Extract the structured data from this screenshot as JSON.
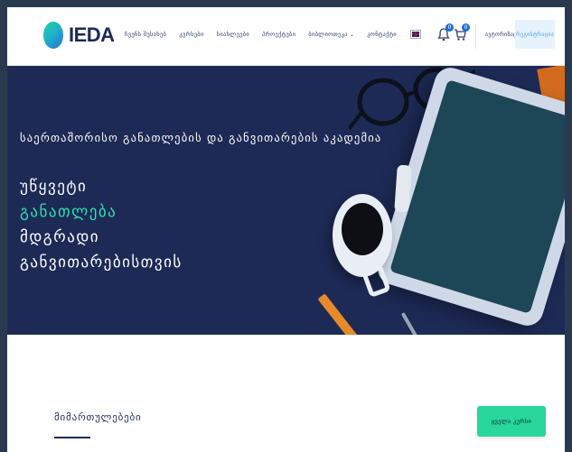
{
  "header": {
    "logo_text": "IEDA",
    "nav": [
      {
        "label": "ჩვენს შესახებ",
        "has_dropdown": false
      },
      {
        "label": "კურსები",
        "has_dropdown": false
      },
      {
        "label": "სიახლეები",
        "has_dropdown": false
      },
      {
        "label": "პროექტები",
        "has_dropdown": false
      },
      {
        "label": "ბიბლიოთეკა",
        "has_dropdown": true
      },
      {
        "label": "კონტაქტი",
        "has_dropdown": false
      }
    ],
    "language_icon": "uk-flag-icon",
    "wishlist_count": "0",
    "cart_count": "0",
    "login_label": "ავტორიზაცია",
    "register_label": "რეგისტრაცია"
  },
  "hero": {
    "subtitle": "საერთაშორისო განათლების და განვითარების აკადემია",
    "lines": [
      "უწყვეტი",
      "განათლება",
      "მდგრადი",
      "განვითარებისთვის"
    ],
    "accent_color": "#2fe0b0",
    "background_color": "#1d2a55"
  },
  "section": {
    "title": "მიმართულებები",
    "all_courses_label": "ყველა კურსი"
  }
}
